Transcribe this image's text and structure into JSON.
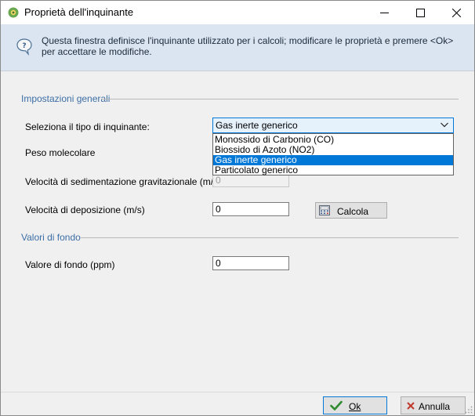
{
  "window": {
    "title": "Proprietà dell'inquinante"
  },
  "info": {
    "text": "Questa finestra definisce l'inquinante utilizzato per i calcoli; modificare le proprietà e premere <Ok> per accettare le modifiche."
  },
  "general": {
    "group_title": "Impostazioni generali",
    "pollutant_type_label": "Seleziona il tipo di inquinante:",
    "pollutant_type_value": "Gas inerte generico",
    "pollutant_options": [
      "Monossido di Carbonio (CO)",
      "Biossido di Azoto (NO2)",
      "Gas inerte generico",
      "Particolato generico"
    ],
    "molecular_weight_label": "Peso molecolare",
    "sedimentation_label": "Velocità di sedimentazione gravitazionale (m/s)",
    "sedimentation_value": "0",
    "deposition_label": "Velocità di deposizione (m/s)",
    "deposition_value": "0",
    "calculate_label": "Calcola"
  },
  "background": {
    "group_title": "Valori di fondo",
    "value_label": "Valore di fondo (ppm)",
    "value": "0"
  },
  "footer": {
    "ok_label": "Ok",
    "cancel_label": "Annulla"
  },
  "colors": {
    "info_band": "#dbe5f1",
    "group_title": "#3c6ea6",
    "selection": "#0078d7"
  }
}
